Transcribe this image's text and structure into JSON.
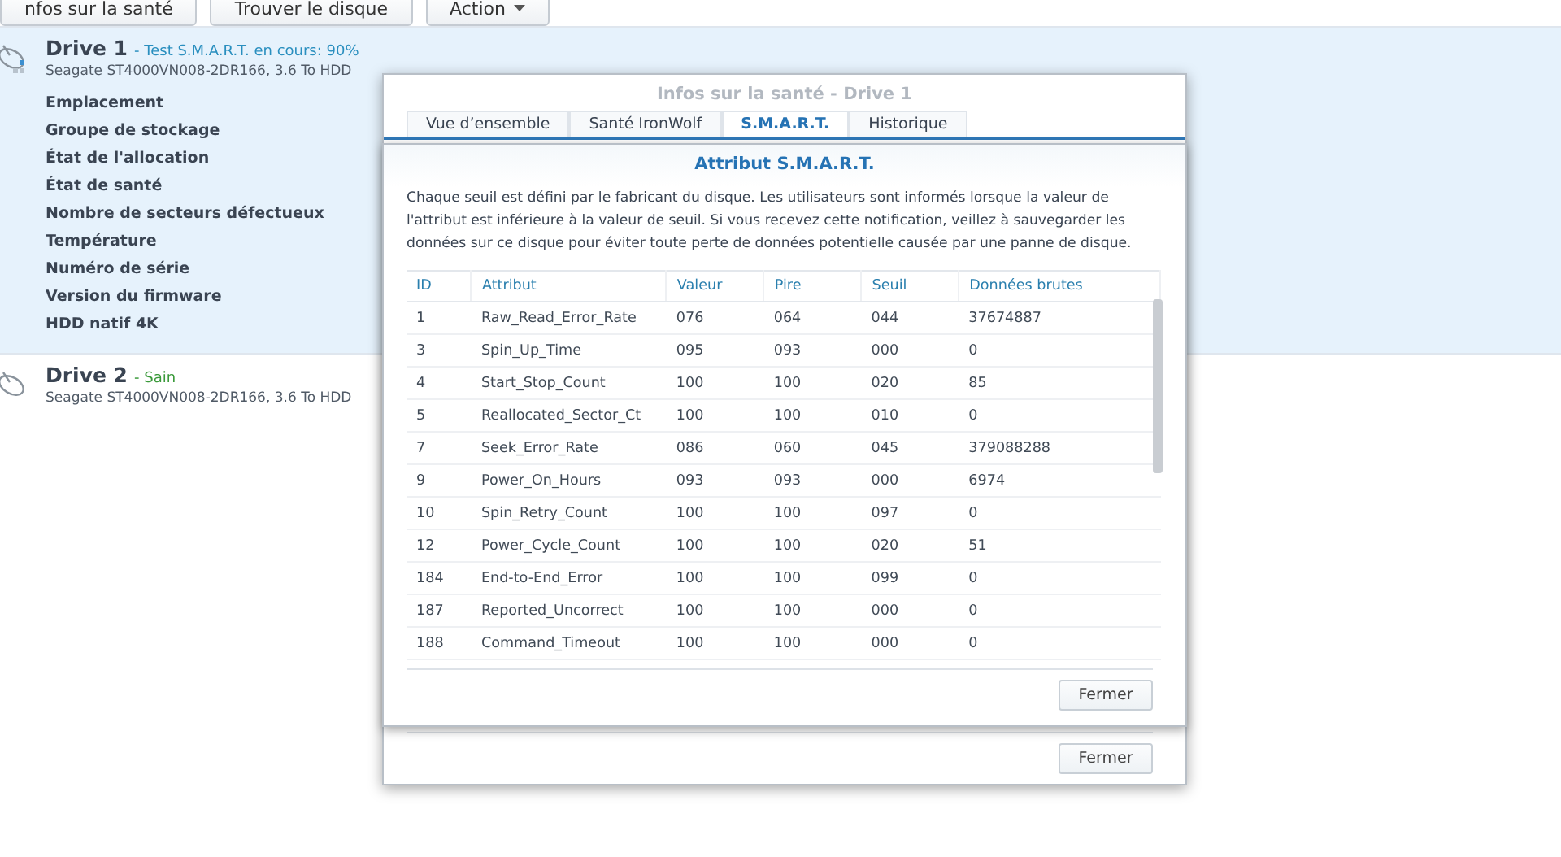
{
  "toolbar": {
    "buttons": [
      {
        "label": "nfos sur la santé",
        "kind": "plain"
      },
      {
        "label": "Trouver le disque",
        "kind": "plain"
      },
      {
        "label": "Action",
        "kind": "dropdown"
      }
    ]
  },
  "drives": [
    {
      "name": "Drive 1",
      "status": "- Test S.M.A.R.T. en cours: 90%",
      "color": "#2a8fbf",
      "model": "Seagate ST4000VN008-2DR166, 3.6 To HDD",
      "selected": true,
      "details": [
        "Emplacement",
        "Groupe de stockage",
        "État de l'allocation",
        "État de santé",
        "Nombre de secteurs défectueux",
        "Température",
        "Numéro de série",
        "Version du firmware",
        "HDD natif 4K"
      ]
    },
    {
      "name": "Drive 2",
      "status": "- Sain",
      "color": "#3a9a3a",
      "model": "Seagate ST4000VN008-2DR166, 3.6 To HDD",
      "selected": false
    }
  ],
  "dialog": {
    "title": "Infos sur la santé - Drive 1",
    "tabs": [
      {
        "label": "Vue d’ensemble",
        "selected": false
      },
      {
        "label": "Santé IronWolf",
        "selected": false
      },
      {
        "label": "S.M.A.R.T.",
        "selected": true
      },
      {
        "label": "Historique",
        "selected": false
      }
    ],
    "button": "Fermer"
  },
  "smart_dialog": {
    "title": "Attribut S.M.A.R.T.",
    "description": "Chaque seuil est défini par le fabricant du disque. Les utilisateurs sont informés lorsque la valeur de l'attribut est inférieure à la valeur de seuil. Si vous recevez cette notification, veillez à sauvegarder les données sur ce disque pour éviter toute perte de données potentielle causée par une panne de disque.",
    "table": {
      "columns": [
        "ID",
        "Attribut",
        "Valeur",
        "Pire",
        "Seuil",
        "Données brutes"
      ],
      "rows": [
        [
          "1",
          "Raw_Read_Error_Rate",
          "076",
          "064",
          "044",
          "37674887"
        ],
        [
          "3",
          "Spin_Up_Time",
          "095",
          "093",
          "000",
          "0"
        ],
        [
          "4",
          "Start_Stop_Count",
          "100",
          "100",
          "020",
          "85"
        ],
        [
          "5",
          "Reallocated_Sector_Ct",
          "100",
          "100",
          "010",
          "0"
        ],
        [
          "7",
          "Seek_Error_Rate",
          "086",
          "060",
          "045",
          "379088288"
        ],
        [
          "9",
          "Power_On_Hours",
          "093",
          "093",
          "000",
          "6974"
        ],
        [
          "10",
          "Spin_Retry_Count",
          "100",
          "100",
          "097",
          "0"
        ],
        [
          "12",
          "Power_Cycle_Count",
          "100",
          "100",
          "020",
          "51"
        ],
        [
          "184",
          "End-to-End_Error",
          "100",
          "100",
          "099",
          "0"
        ],
        [
          "187",
          "Reported_Uncorrect",
          "100",
          "100",
          "000",
          "0"
        ],
        [
          "188",
          "Command_Timeout",
          "100",
          "100",
          "000",
          "0"
        ]
      ]
    },
    "button": "Fermer"
  }
}
